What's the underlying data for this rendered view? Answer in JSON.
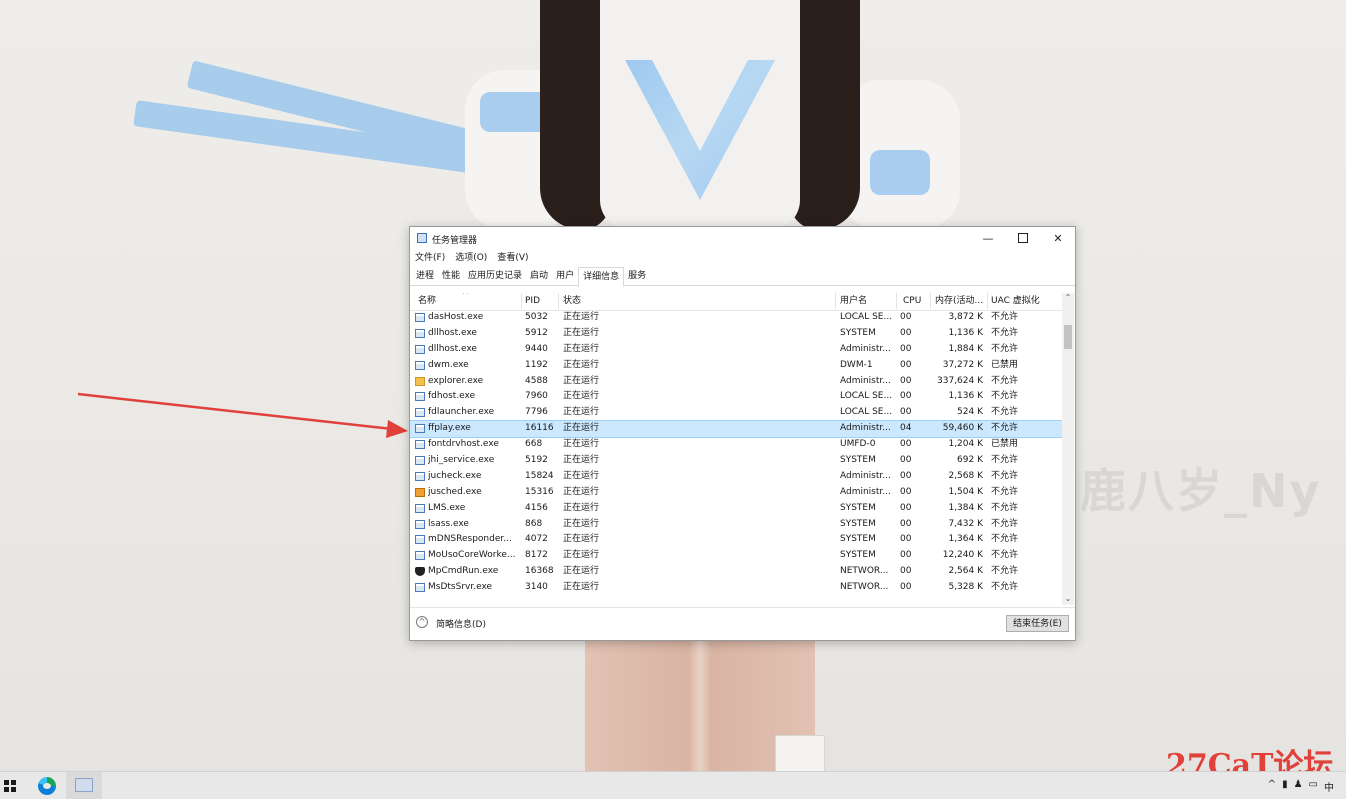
{
  "wallpaper": {
    "watermark": "鹿八岁_Ny",
    "forum_logo": "27CaT论坛"
  },
  "window": {
    "title": "任务管理器",
    "controls": {
      "minimize": "—",
      "close": "✕"
    },
    "menu": [
      "文件(F)",
      "选项(O)",
      "查看(V)"
    ],
    "tabs": [
      "进程",
      "性能",
      "应用历史记录",
      "启动",
      "用户",
      "详细信息",
      "服务"
    ],
    "active_tab": "详细信息",
    "columns": {
      "name": "名称",
      "pid": "PID",
      "status": "状态",
      "user": "用户名",
      "cpu": "CPU",
      "mem": "内存(活动...",
      "uac": "UAC 虚拟化"
    },
    "rows": [
      {
        "icon": "exe-icon",
        "name": "dasHost.exe",
        "pid": "5032",
        "status": "正在运行",
        "user": "LOCAL SE...",
        "cpu": "00",
        "mem": "3,872 K",
        "uac": "不允许"
      },
      {
        "icon": "exe-icon",
        "name": "dllhost.exe",
        "pid": "5912",
        "status": "正在运行",
        "user": "SYSTEM",
        "cpu": "00",
        "mem": "1,136 K",
        "uac": "不允许"
      },
      {
        "icon": "exe-icon",
        "name": "dllhost.exe",
        "pid": "9440",
        "status": "正在运行",
        "user": "Administr...",
        "cpu": "00",
        "mem": "1,884 K",
        "uac": "不允许"
      },
      {
        "icon": "exe-icon",
        "name": "dwm.exe",
        "pid": "1192",
        "status": "正在运行",
        "user": "DWM-1",
        "cpu": "00",
        "mem": "37,272 K",
        "uac": "已禁用"
      },
      {
        "icon": "explorer-icon",
        "name": "explorer.exe",
        "pid": "4588",
        "status": "正在运行",
        "user": "Administr...",
        "cpu": "00",
        "mem": "337,624 K",
        "uac": "不允许"
      },
      {
        "icon": "exe-icon",
        "name": "fdhost.exe",
        "pid": "7960",
        "status": "正在运行",
        "user": "LOCAL SE...",
        "cpu": "00",
        "mem": "1,136 K",
        "uac": "不允许"
      },
      {
        "icon": "exe-icon",
        "name": "fdlauncher.exe",
        "pid": "7796",
        "status": "正在运行",
        "user": "LOCAL SE...",
        "cpu": "00",
        "mem": "524 K",
        "uac": "不允许"
      },
      {
        "icon": "exe-icon",
        "name": "ffplay.exe",
        "pid": "16116",
        "status": "正在运行",
        "user": "Administr...",
        "cpu": "04",
        "mem": "59,460 K",
        "uac": "不允许",
        "selected": true
      },
      {
        "icon": "exe-icon",
        "name": "fontdrvhost.exe",
        "pid": "668",
        "status": "正在运行",
        "user": "UMFD-0",
        "cpu": "00",
        "mem": "1,204 K",
        "uac": "已禁用"
      },
      {
        "icon": "exe-icon",
        "name": "jhi_service.exe",
        "pid": "5192",
        "status": "正在运行",
        "user": "SYSTEM",
        "cpu": "00",
        "mem": "692 K",
        "uac": "不允许"
      },
      {
        "icon": "exe-icon",
        "name": "jucheck.exe",
        "pid": "15824",
        "status": "正在运行",
        "user": "Administr...",
        "cpu": "00",
        "mem": "2,568 K",
        "uac": "不允许"
      },
      {
        "icon": "java-icon",
        "name": "jusched.exe",
        "pid": "15316",
        "status": "正在运行",
        "user": "Administr...",
        "cpu": "00",
        "mem": "1,504 K",
        "uac": "不允许"
      },
      {
        "icon": "exe-icon",
        "name": "LMS.exe",
        "pid": "4156",
        "status": "正在运行",
        "user": "SYSTEM",
        "cpu": "00",
        "mem": "1,384 K",
        "uac": "不允许"
      },
      {
        "icon": "exe-icon",
        "name": "lsass.exe",
        "pid": "868",
        "status": "正在运行",
        "user": "SYSTEM",
        "cpu": "00",
        "mem": "7,432 K",
        "uac": "不允许"
      },
      {
        "icon": "exe-icon",
        "name": "mDNSResponder...",
        "pid": "4072",
        "status": "正在运行",
        "user": "SYSTEM",
        "cpu": "00",
        "mem": "1,364 K",
        "uac": "不允许"
      },
      {
        "icon": "exe-icon",
        "name": "MoUsoCoreWorke...",
        "pid": "8172",
        "status": "正在运行",
        "user": "SYSTEM",
        "cpu": "00",
        "mem": "12,240 K",
        "uac": "不允许"
      },
      {
        "icon": "shield-icon",
        "name": "MpCmdRun.exe",
        "pid": "16368",
        "status": "正在运行",
        "user": "NETWOR...",
        "cpu": "00",
        "mem": "2,564 K",
        "uac": "不允许"
      },
      {
        "icon": "exe-icon",
        "name": "MsDtsSrvr.exe",
        "pid": "3140",
        "status": "正在运行",
        "user": "NETWOR...",
        "cpu": "00",
        "mem": "5,328 K",
        "uac": "不允许"
      }
    ],
    "footer": {
      "fewer_details": "简略信息(D)",
      "end_task": "结束任务(E)"
    }
  },
  "taskbar": {
    "tray": [
      "^",
      "中"
    ]
  },
  "colors": {
    "annotation_arrow": "#e0413a",
    "selection": "#cce8ff",
    "logo": "#e0413a"
  }
}
